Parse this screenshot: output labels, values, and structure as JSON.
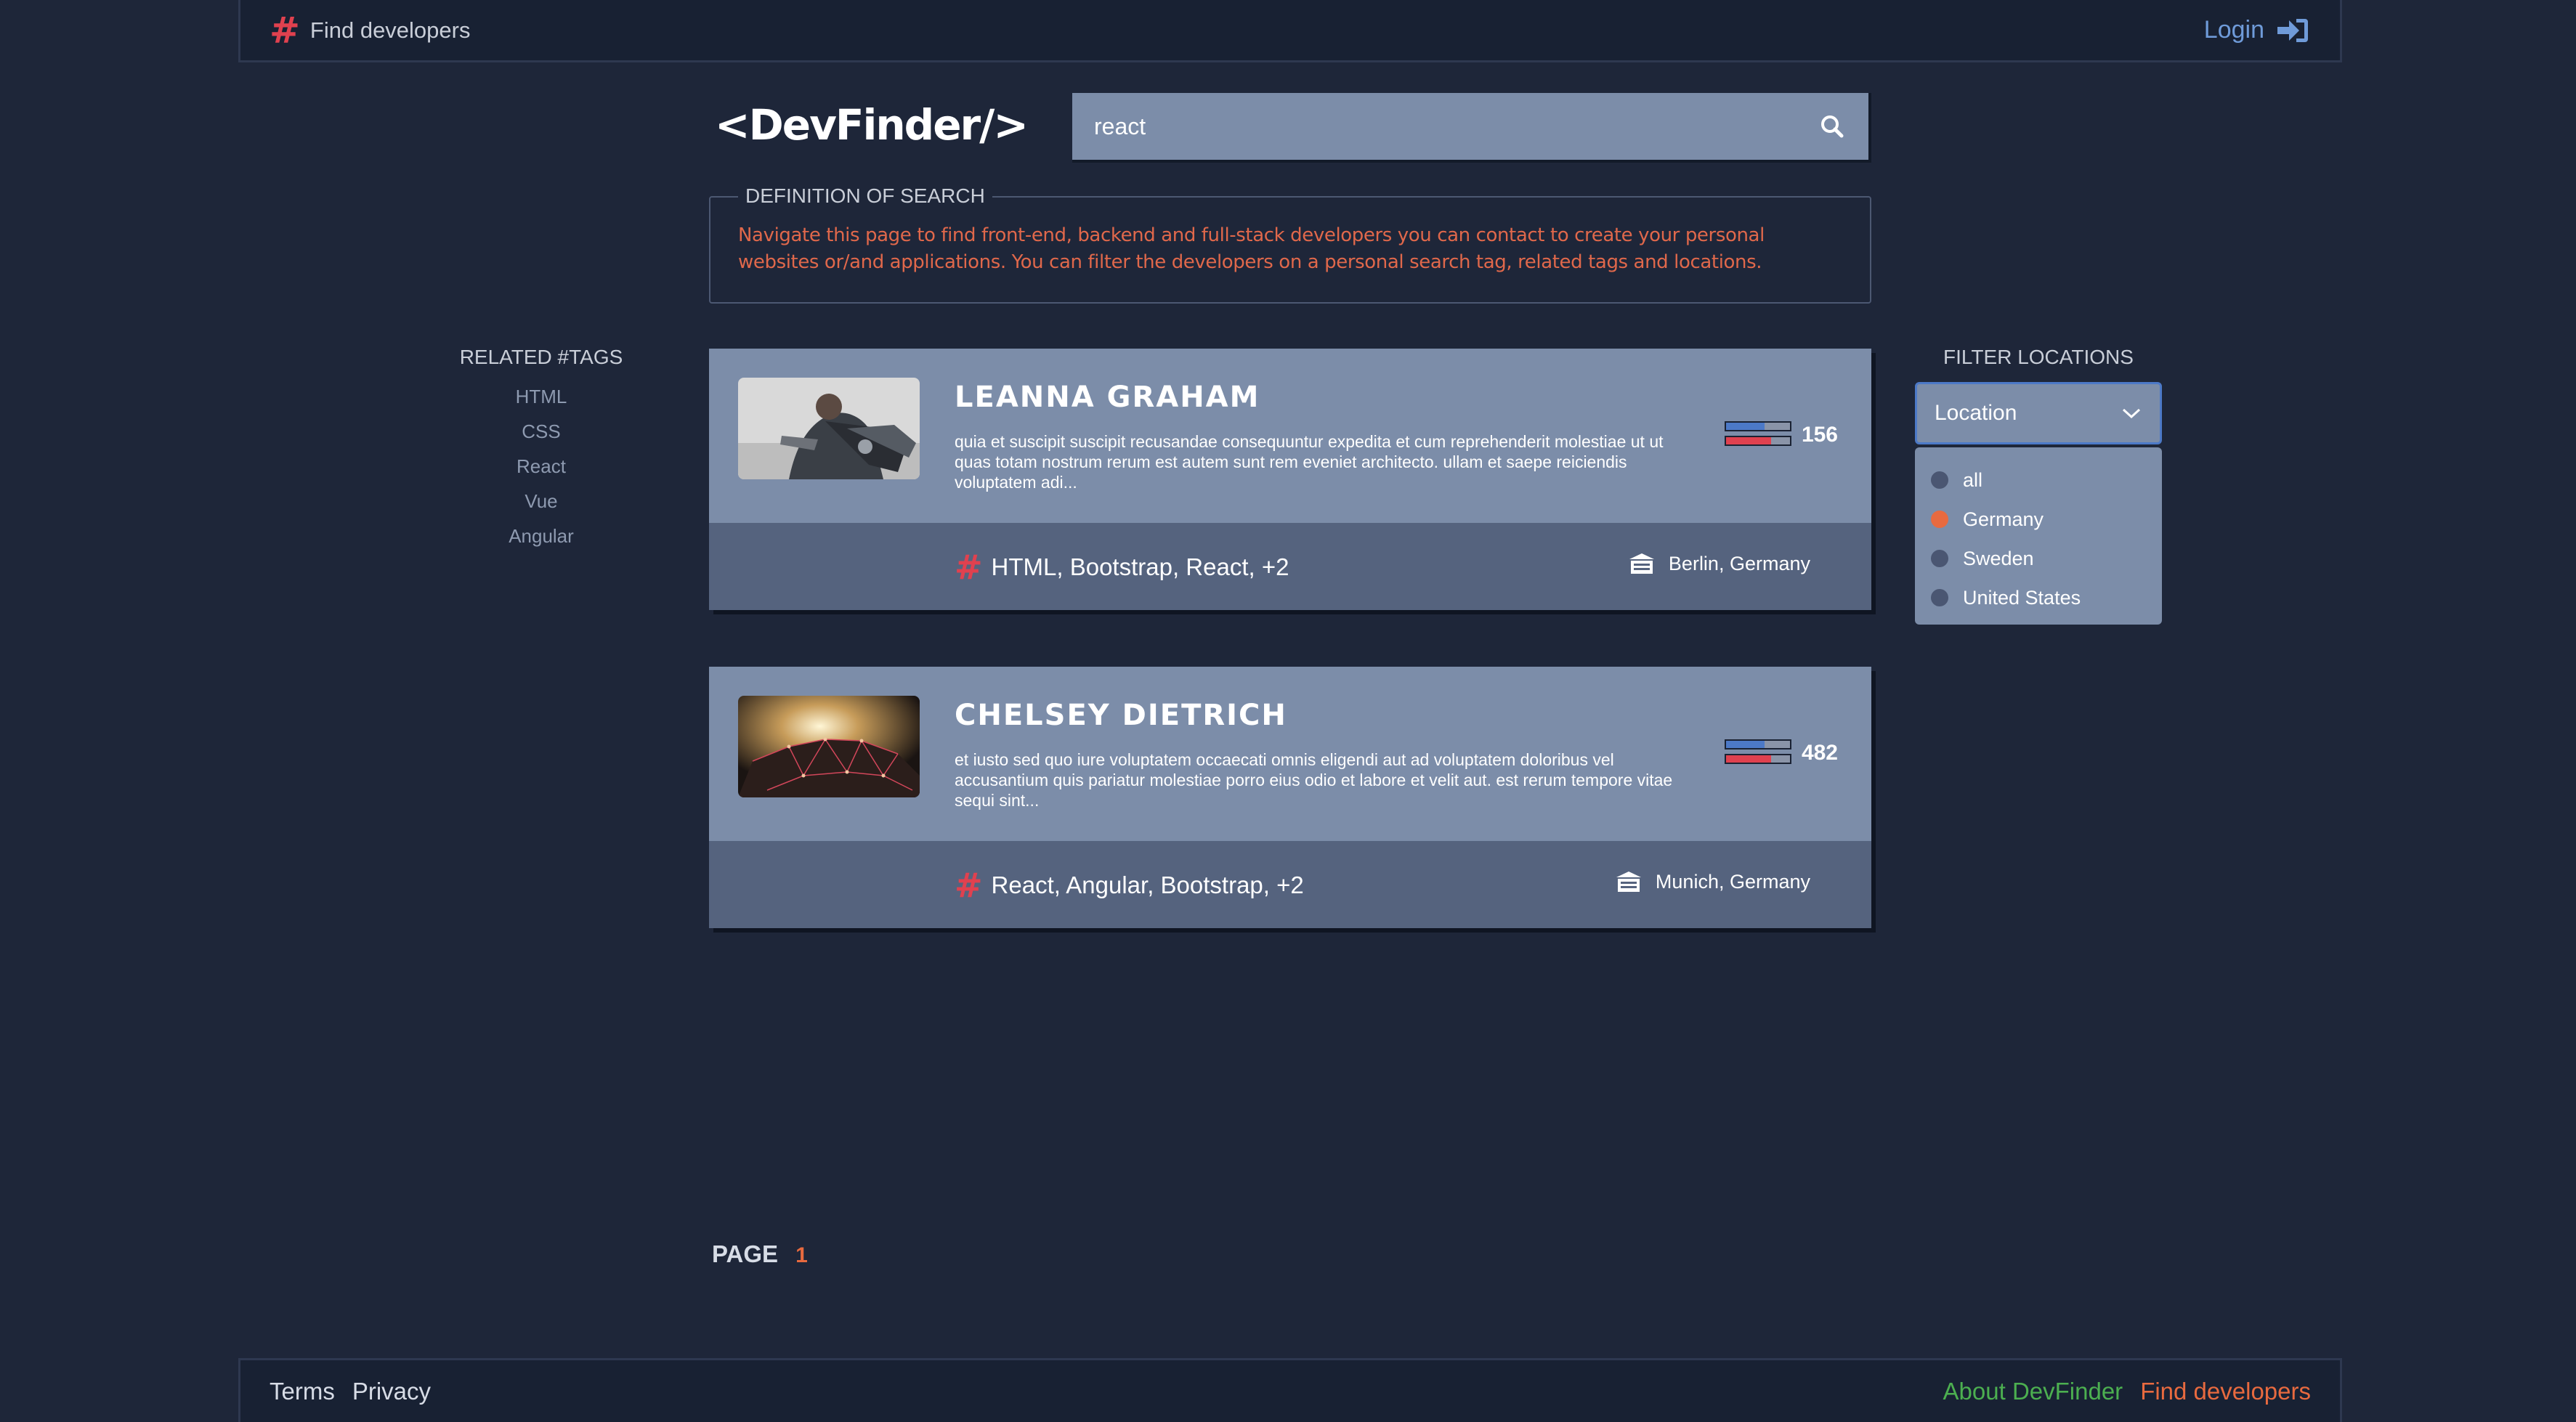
{
  "nav": {
    "brand_label": "Find developers",
    "login_label": "Login"
  },
  "logo": "<DevFinder/>",
  "search": {
    "value": "react"
  },
  "definition": {
    "legend": "DEFINITION OF SEARCH",
    "text": "Navigate this page to find front-end, backend and full-stack developers you can contact to create your personal websites or/and applications. You can filter the developers on a personal search tag, related tags and locations."
  },
  "related_tags": {
    "title": "RELATED #TAGS",
    "items": [
      "HTML",
      "CSS",
      "React",
      "Vue",
      "Angular"
    ]
  },
  "filter": {
    "title": "FILTER LOCATIONS",
    "selected": "Location",
    "options": [
      {
        "label": "all",
        "checked": false
      },
      {
        "label": "Germany",
        "checked": true
      },
      {
        "label": "Sweden",
        "checked": false
      },
      {
        "label": "United States",
        "checked": false
      }
    ]
  },
  "developers": [
    {
      "name": "LEANNA GRAHAM",
      "bio": "quia et suscipit suscipit recusandae consequuntur expedita et cum reprehenderit molestiae ut ut quas totam nostrum rerum est autem sunt rem eveniet architecto. ullam et saepe reiciendis voluptatem adi...",
      "rating": "156",
      "tags": "HTML, Bootstrap, React, +2",
      "location": "Berlin, Germany"
    },
    {
      "name": "CHELSEY DIETRICH",
      "bio": "et iusto sed quo iure voluptatem occaecati omnis eligendi aut ad voluptatem doloribus vel accusantium quis pariatur molestiae porro eius odio et labore et velit aut. est rerum tempore vitae sequi sint...",
      "rating": "482",
      "tags": "React, Angular, Bootstrap, +2",
      "location": "Munich, Germany"
    }
  ],
  "pager": {
    "label": "PAGE",
    "current": "1"
  },
  "footer": {
    "terms": "Terms",
    "privacy": "Privacy",
    "about": "About DevFinder",
    "find": "Find developers"
  },
  "colors": {
    "background": "#1e2639",
    "accent_red": "#e0414f",
    "accent_orange": "#e86a3f",
    "card": "#7c8da9",
    "link_blue": "#6f9bd9",
    "about_green": "#4caf50"
  }
}
